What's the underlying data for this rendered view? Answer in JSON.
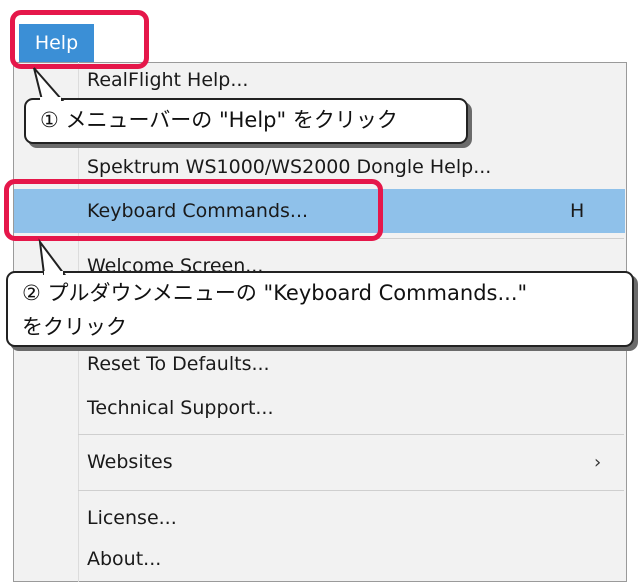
{
  "menubar": {
    "help_label": "Help"
  },
  "menu": {
    "items": [
      {
        "label": "RealFlight Help..."
      },
      {
        "label": "Spektrum WS1000/WS2000 Dongle Help..."
      },
      {
        "label": "Keyboard Commands...",
        "shortcut": "H"
      },
      {
        "label": "Welcome Screen..."
      },
      {
        "label": "Reset To Defaults..."
      },
      {
        "label": "Technical Support..."
      },
      {
        "label": "Websites",
        "submenu_icon": "chevron-right-icon",
        "chevron": "›"
      },
      {
        "label": "License..."
      },
      {
        "label": "About..."
      }
    ]
  },
  "callouts": {
    "step1": "① メニューバーの \"Help\" をクリック",
    "step2_line1": "② プルダウンメニューの \"Keyboard Commands...\"",
    "step2_line2": "をクリック"
  },
  "colors": {
    "highlight_box": "#e5174a",
    "menubar_selected": "#3b8fd6",
    "menu_item_hover": "#8fc1ea",
    "menu_background": "#f2f2f2"
  }
}
